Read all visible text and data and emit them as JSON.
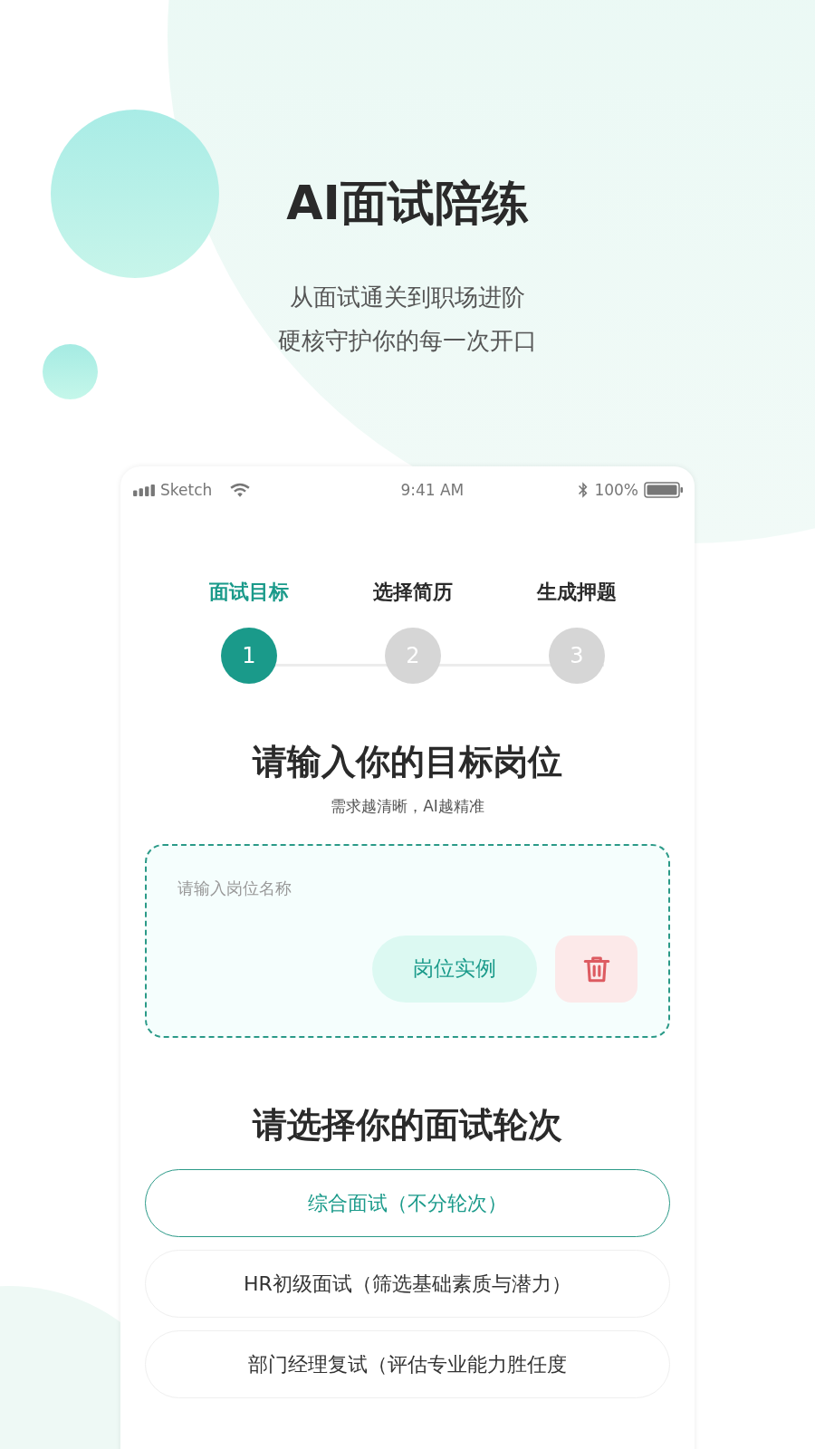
{
  "hero": {
    "title": "AI面试陪练",
    "subtitle_lines": [
      "从面试通关到职场进阶",
      "硬核守护你的每一次开口"
    ]
  },
  "status_bar": {
    "carrier": "Sketch",
    "time": "9:41 AM",
    "battery": "100%"
  },
  "steps": [
    {
      "label": "面试目标",
      "number": "1",
      "selected": true
    },
    {
      "label": "选择简历",
      "number": "2",
      "selected": false
    },
    {
      "label": "生成押题",
      "number": "3",
      "selected": false
    }
  ],
  "position_section": {
    "heading": "请输入你的目标岗位",
    "hint": "需求越清晰，AI越精准",
    "input": {
      "placeholder": "请输入岗位名称"
    },
    "example_button": "岗位实例"
  },
  "round_section": {
    "heading": "请选择你的面试轮次",
    "options": [
      {
        "label": "综合面试（不分轮次）",
        "selected": true
      },
      {
        "label": "HR初级面试（筛选基础素质与潜力）",
        "selected": false
      },
      {
        "label": "部门经理复试（评估专业能力胜任度",
        "selected": false
      }
    ]
  }
}
